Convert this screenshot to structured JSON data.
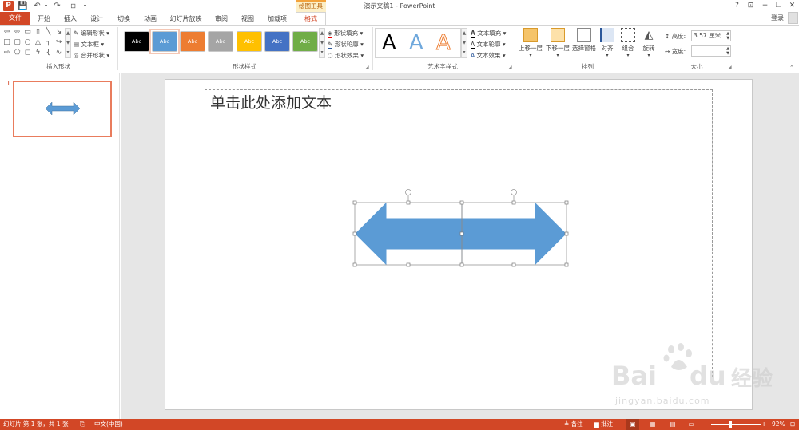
{
  "window": {
    "title": "演示文稿1 - PowerPoint",
    "context_group": "绘图工具",
    "signin": "登录",
    "help": "?"
  },
  "tabs": {
    "file": "文件",
    "items": [
      "开始",
      "插入",
      "设计",
      "切换",
      "动画",
      "幻灯片放映",
      "审阅",
      "视图",
      "加载项"
    ],
    "active": "格式"
  },
  "ribbon": {
    "insert_shapes": {
      "label": "插入形状",
      "edit_shape": "编辑形状",
      "text_box": "文本框",
      "merge_shapes": "合并形状"
    },
    "shape_styles": {
      "label": "形状样式",
      "swatch_text": "Abc",
      "swatch_colors": [
        "#000000",
        "#5b9bd5",
        "#ed7d31",
        "#a5a5a5",
        "#ffc000",
        "#4472c4",
        "#70ad47"
      ],
      "fill": "形状填充",
      "outline": "形状轮廓",
      "effects": "形状效果"
    },
    "wordart": {
      "label": "艺术字样式",
      "glyph": "A",
      "fill": "文本填充",
      "outline": "文本轮廓",
      "effects": "文本效果"
    },
    "arrange": {
      "label": "排列",
      "bring_forward": "上移一层",
      "send_backward": "下移一层",
      "selection_pane": "选择窗格",
      "align": "对齐",
      "group": "组合",
      "rotate": "旋转"
    },
    "size": {
      "label": "大小",
      "height_label": "高度:",
      "height_value": "3.57 厘米",
      "width_label": "宽度:",
      "width_value": ""
    }
  },
  "thumbnail": {
    "number": "1"
  },
  "slide": {
    "placeholder_text": "单击此处添加文本",
    "arrow_color": "#5b9bd5"
  },
  "status": {
    "slide_info": "幻灯片 第 1 张，共 1 张",
    "language": "中文(中国)",
    "notes": "备注",
    "comments": "批注",
    "zoom": "92%"
  },
  "watermark": {
    "brand": "Bai",
    "brand2": "du",
    "chinese": "经验",
    "url": "jingyan.baidu.com"
  },
  "colors": {
    "accent": "#d24726"
  }
}
